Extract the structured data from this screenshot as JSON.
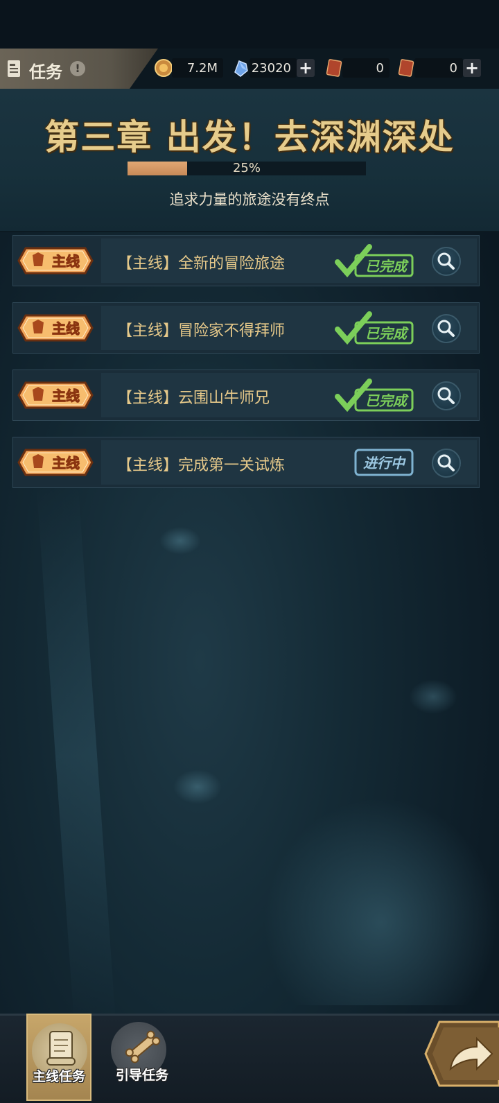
{
  "header": {
    "title": "任务",
    "info_glyph": "!",
    "resources": [
      {
        "name": "gold",
        "icon": "gold-coin-icon",
        "value": "7.2M"
      },
      {
        "name": "diamond",
        "icon": "blue-crystal-icon",
        "value": "23020"
      },
      {
        "name": "ticket-a",
        "icon": "red-card-icon",
        "value": "0"
      },
      {
        "name": "ticket-b",
        "icon": "red-card-icon",
        "value": "0"
      }
    ],
    "plus_glyph": "+"
  },
  "chapter": {
    "title": "第三章 出发！去深渊深处",
    "progress_text": "25%",
    "progress_fraction": 0.25,
    "subtitle": "追求力量的旅途没有终点"
  },
  "quests": [
    {
      "tag": "主线",
      "text": "【主线】全新的冒险旅途",
      "status": "已完成",
      "status_type": "completed"
    },
    {
      "tag": "主线",
      "text": "【主线】冒险家不得拜师",
      "status": "已完成",
      "status_type": "completed"
    },
    {
      "tag": "主线",
      "text": "【主线】云围山牛师兄",
      "status": "已完成",
      "status_type": "completed"
    },
    {
      "tag": "主线",
      "text": "【主线】完成第一关试炼",
      "status": "进行中",
      "status_type": "in-progress"
    }
  ],
  "tabs": [
    {
      "label": "主线任务",
      "icon": "scroll-icon",
      "selected": true
    },
    {
      "label": "引导任务",
      "icon": "bone-scroll-icon",
      "selected": false
    }
  ],
  "colors": {
    "gold_text": "#e6c98a",
    "completed_green": "#7ccf5a",
    "in_progress_blue": "#7fb3d1",
    "progress_fill": "#d39b66"
  }
}
